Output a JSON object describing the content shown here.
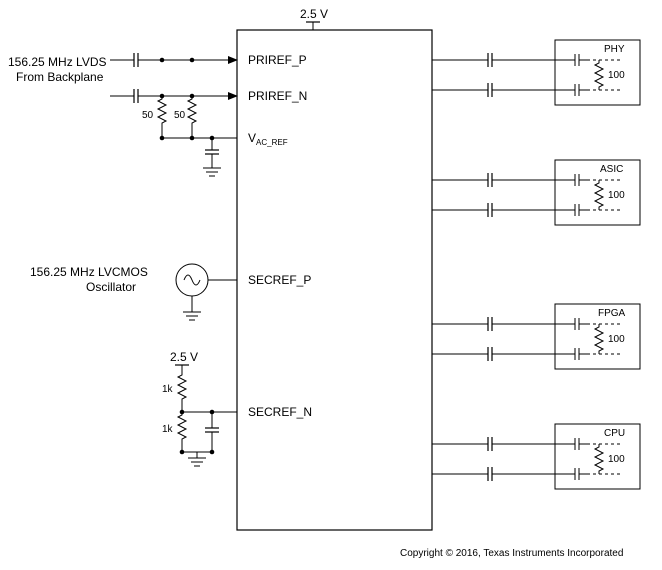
{
  "supply": {
    "voltage": "2.5 V"
  },
  "left": {
    "lvds": {
      "line1": "156.25 MHz LVDS",
      "line2": "From Backplane",
      "term1": "50",
      "term2": "50"
    },
    "oscillator": {
      "line1": "156.25 MHz LVCMOS",
      "line2": "Oscillator"
    },
    "secref_n": {
      "voltage": "2.5 V",
      "r1": "1k",
      "r2": "1k"
    }
  },
  "pins": {
    "priref_p": "PRIREF_P",
    "priref_n": "PRIREF_N",
    "vac_ref_prefix": "V",
    "vac_ref_sub": "AC_REF",
    "secref_p": "SECREF_P",
    "secref_n": "SECREF_N"
  },
  "loads": {
    "phy": {
      "label": "PHY",
      "res": "100"
    },
    "asic": {
      "label": "ASIC",
      "res": "100"
    },
    "fpga": {
      "label": "FPGA",
      "res": "100"
    },
    "cpu": {
      "label": "CPU",
      "res": "100"
    }
  },
  "copyright": "Copyright © 2016, Texas Instruments Incorporated"
}
